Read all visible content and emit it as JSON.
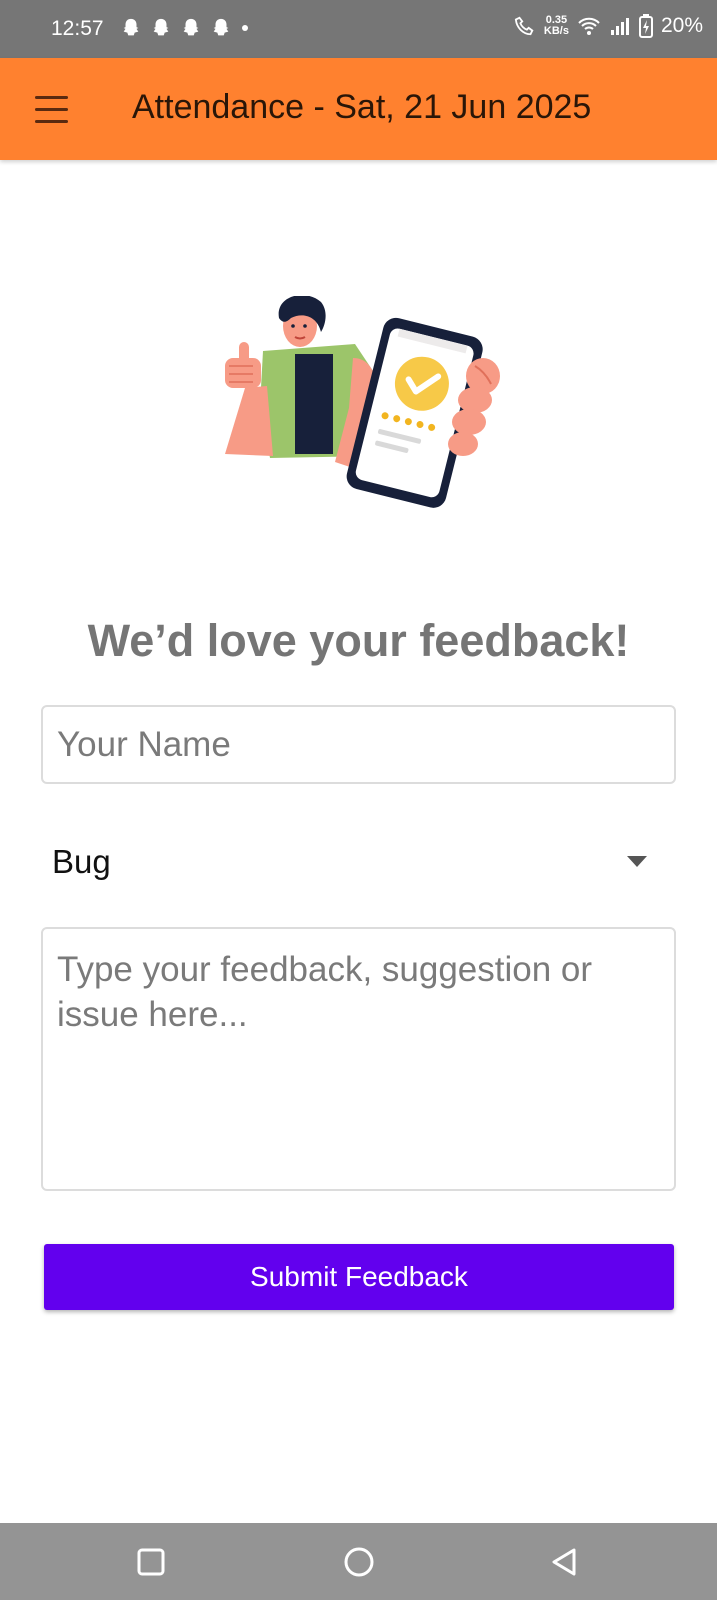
{
  "status_bar": {
    "time": "12:57",
    "speed_value": "0.35",
    "speed_unit": "KB/s",
    "battery_percent": "20%",
    "icons": [
      "snapchat-icon",
      "snapchat-icon",
      "snapchat-icon",
      "snapchat-icon",
      "dot-icon",
      "wifi-call-icon",
      "wifi-icon",
      "signal-icon",
      "battery-charging-icon"
    ]
  },
  "app_bar": {
    "title": "Attendance - Sat, 21 Jun 2025",
    "menu_icon": "hamburger-menu-icon",
    "background": "#FF812F"
  },
  "main": {
    "heading": "We’d love your feedback!",
    "name_placeholder": "Your Name",
    "name_value": "",
    "category_value": "Bug",
    "feedback_placeholder": "Type your feedback, suggestion or issue here...",
    "feedback_value": "",
    "submit_label": "Submit Feedback",
    "submit_color": "#6200EE"
  },
  "nav_bar": {
    "buttons": [
      "recents-square-icon",
      "home-circle-icon",
      "back-triangle-icon"
    ]
  }
}
